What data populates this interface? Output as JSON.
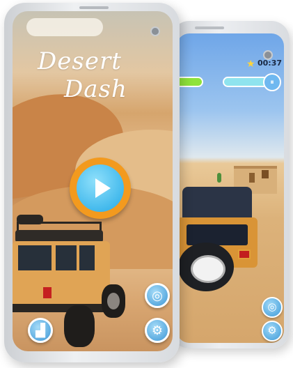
{
  "menu_screen": {
    "title_line1": "Desert",
    "title_line2": "Dash",
    "play_button": "play-icon",
    "side_buttons": [
      "target-icon",
      "settings-icon"
    ],
    "left_button": "leaderboard-icon",
    "accent_color": "#f39a1e",
    "button_color": "#3f9bd8"
  },
  "game_screen": {
    "star_icon": "★",
    "timer": "00:37",
    "left_bar_color": "#8fe33b",
    "right_bar_color": "#8fe3ee",
    "side_buttons": [
      "target-icon",
      "settings-icon"
    ]
  },
  "icons": {
    "play": "▶",
    "target": "◎",
    "settings": "⚙",
    "leaderboard": "▟",
    "bar_badge": "⏸"
  }
}
